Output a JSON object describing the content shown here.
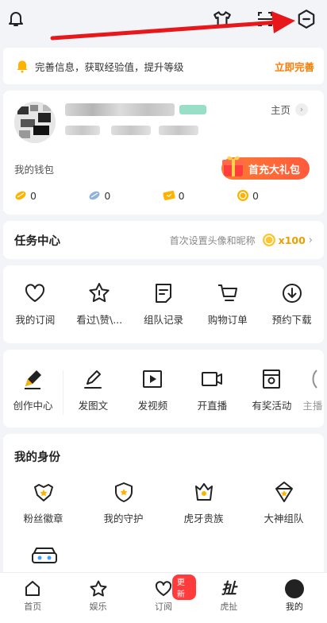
{
  "topbar": {
    "icons": [
      "bell-icon",
      "shirt-icon",
      "scan-icon",
      "settings-icon"
    ]
  },
  "notice": {
    "text": "完善信息，获取经验值，提升等级",
    "action": "立即完善"
  },
  "profile": {
    "home_label": "主页",
    "chevron": "›"
  },
  "wallet": {
    "label": "我的钱包",
    "gift_label": "首充大礼包",
    "coins": [
      {
        "icon": "gold-bean-icon",
        "value": "0"
      },
      {
        "icon": "silver-bean-icon",
        "value": "0"
      },
      {
        "icon": "ticket-icon",
        "value": "0"
      },
      {
        "icon": "coin-icon",
        "value": "0"
      }
    ]
  },
  "task": {
    "title": "任务中心",
    "subtitle": "首次设置头像和昵称",
    "points": "x100",
    "chevron": "›"
  },
  "quick": [
    {
      "icon": "heart-icon",
      "label": "我的订阅"
    },
    {
      "icon": "star-icon",
      "label": "看过\\赞\\..."
    },
    {
      "icon": "note-icon",
      "label": "组队记录"
    },
    {
      "icon": "cart-icon",
      "label": "购物订单"
    },
    {
      "icon": "download-icon",
      "label": "预约下载"
    }
  ],
  "create": [
    {
      "icon": "pen-icon",
      "label": "创作中心"
    },
    {
      "icon": "edit-icon",
      "label": "发图文"
    },
    {
      "icon": "video-icon",
      "label": "发视频"
    },
    {
      "icon": "camera-icon",
      "label": "开直播"
    },
    {
      "icon": "gift-box-icon",
      "label": "有奖活动"
    },
    {
      "icon": "more-icon",
      "label": "主播"
    }
  ],
  "identity": {
    "title": "我的身份",
    "items": [
      {
        "icon": "fan-badge-icon",
        "label": "粉丝徽章"
      },
      {
        "icon": "guard-icon",
        "label": "我的守护"
      },
      {
        "icon": "crown-icon",
        "label": "虎牙贵族"
      },
      {
        "icon": "team-icon",
        "label": "大神组队"
      }
    ],
    "extra_icon": "vr-icon"
  },
  "tabbar": {
    "items": [
      {
        "icon": "home-icon",
        "label": "首页"
      },
      {
        "icon": "star-icon",
        "label": "娱乐"
      },
      {
        "icon": "heart-icon",
        "label": "订阅"
      },
      {
        "icon": "huya-logo-icon",
        "label": "虎扯",
        "logo": "扯"
      },
      {
        "icon": "avatar-icon",
        "label": "我的"
      }
    ],
    "new_badge": "更新"
  }
}
